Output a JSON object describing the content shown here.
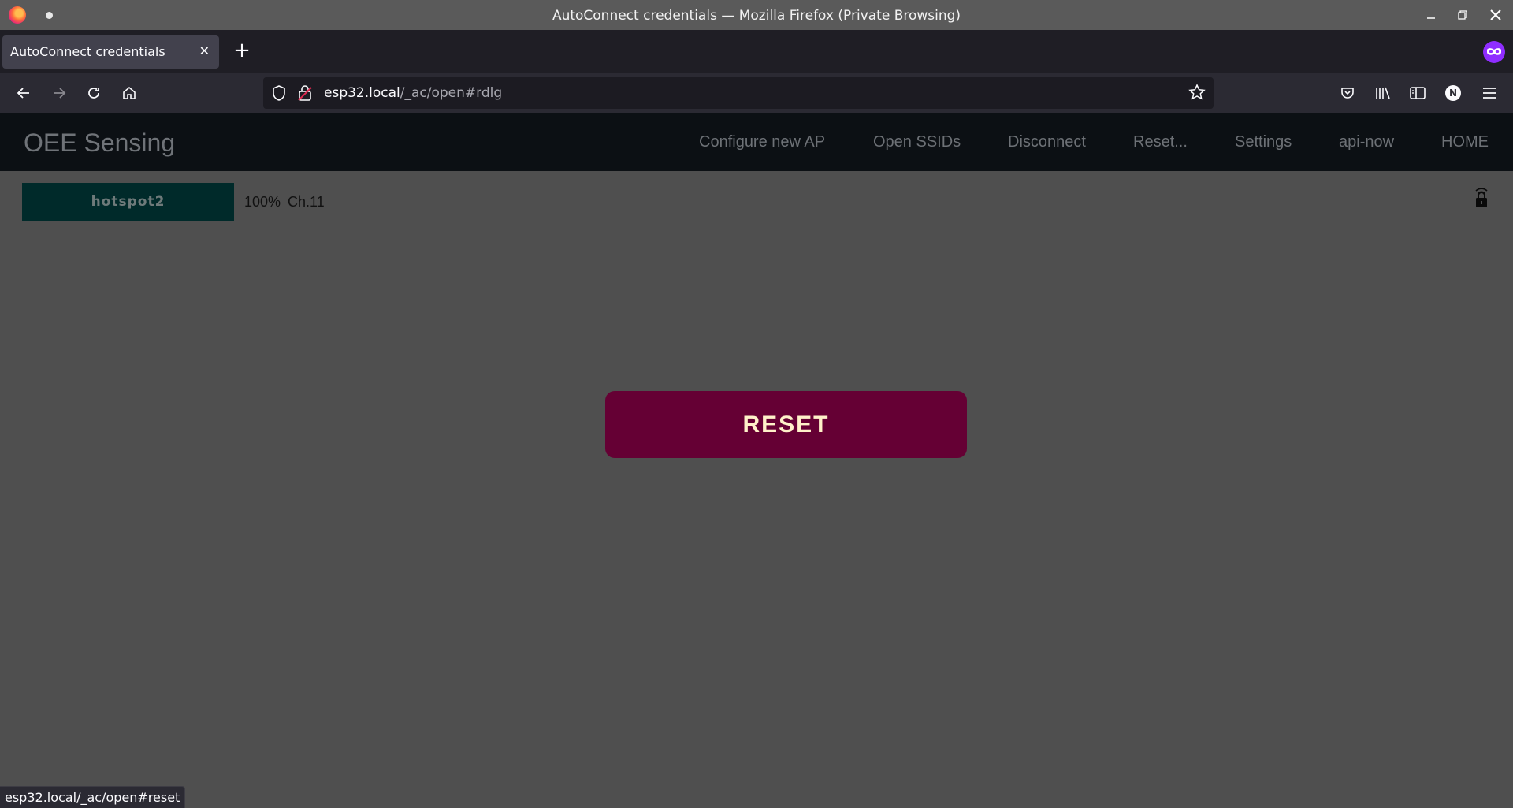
{
  "window": {
    "title": "AutoConnect credentials — Mozilla Firefox (Private Browsing)",
    "controls": [
      "minimize-icon",
      "maximize-icon",
      "close-icon"
    ]
  },
  "tabs": [
    {
      "label": "AutoConnect credentials",
      "active": true
    }
  ],
  "urlbar": {
    "host": "esp32.local",
    "path": "/_ac/open#rdlg"
  },
  "site": {
    "brand": "OEE Sensing",
    "menu": [
      "Configure new AP",
      "Open SSIDs",
      "Disconnect",
      "Reset...",
      "Settings",
      "api-now",
      "HOME"
    ]
  },
  "ap_list": [
    {
      "ssid": "hotspot2",
      "signal": "100%",
      "channel": "Ch.11",
      "secured": true
    }
  ],
  "reset_button": {
    "label": "RESET"
  },
  "statusbar": {
    "text": "esp32.local/_ac/open#reset"
  },
  "colors": {
    "page_bg": "#4f4f4f",
    "header_bg": "#0c1014",
    "reset_bg": "#650034",
    "reset_text": "#fff1c9",
    "ap_bg": "#002a2a"
  }
}
